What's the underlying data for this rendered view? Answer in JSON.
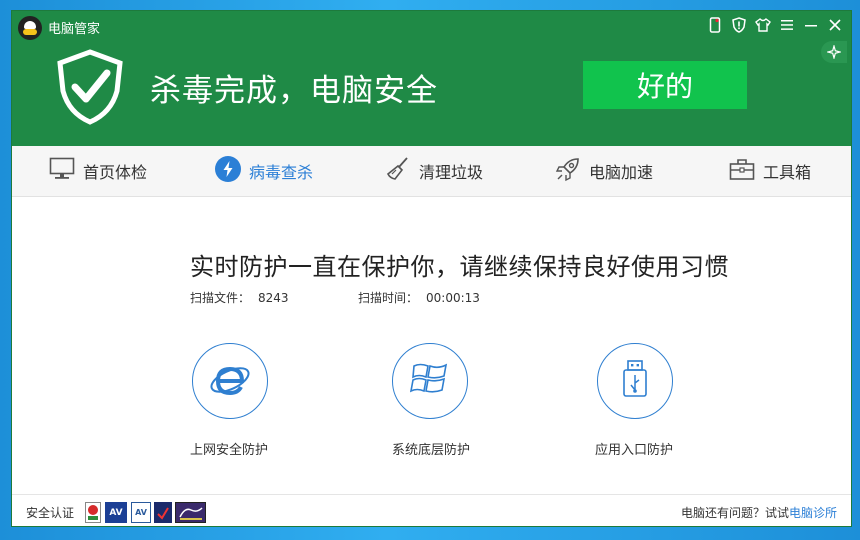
{
  "app": {
    "title": "电脑管家"
  },
  "titlebar": {
    "icons": [
      "phone-icon",
      "shield-badge-icon",
      "tshirt-skin-icon",
      "menu-icon",
      "minimize-icon",
      "close-icon"
    ]
  },
  "status": {
    "title": "杀毒完成，电脑安全",
    "ok_button": "好的"
  },
  "nav": {
    "items": [
      {
        "label": "首页体检",
        "icon": "monitor-icon"
      },
      {
        "label": "病毒查杀",
        "icon": "lightning-icon"
      },
      {
        "label": "清理垃圾",
        "icon": "broom-icon"
      },
      {
        "label": "电脑加速",
        "icon": "rocket-icon"
      },
      {
        "label": "工具箱",
        "icon": "toolbox-icon"
      }
    ],
    "active_color": "#2b7fd6"
  },
  "main": {
    "heading": "实时防护一直在保护你，请继续保持良好使用习惯",
    "scan_files_label": "扫描文件：",
    "scan_files_value": "8243",
    "scan_time_label": "扫描时间：",
    "scan_time_value": "00:00:13",
    "protections": [
      {
        "label": "上网安全防护",
        "icon": "ie-browser-icon"
      },
      {
        "label": "系统底层防护",
        "icon": "windows-logo-icon"
      },
      {
        "label": "应用入口防护",
        "icon": "usb-drive-icon"
      }
    ]
  },
  "footer": {
    "cert_label": "安全认证",
    "badges": [
      {
        "text": "AV",
        "color": "#1c3f95"
      },
      {
        "text": "AV",
        "color": "#2a5a9c"
      },
      {
        "text": "",
        "color": "#1b2a6b"
      },
      {
        "text": "",
        "color": "#3a2a6b"
      }
    ],
    "question": "电脑还有问题？试试",
    "link": "电脑诊所"
  },
  "colors": {
    "header": "#1f8a46",
    "ok_button": "#11c34d",
    "accent": "#2b7fd6"
  }
}
